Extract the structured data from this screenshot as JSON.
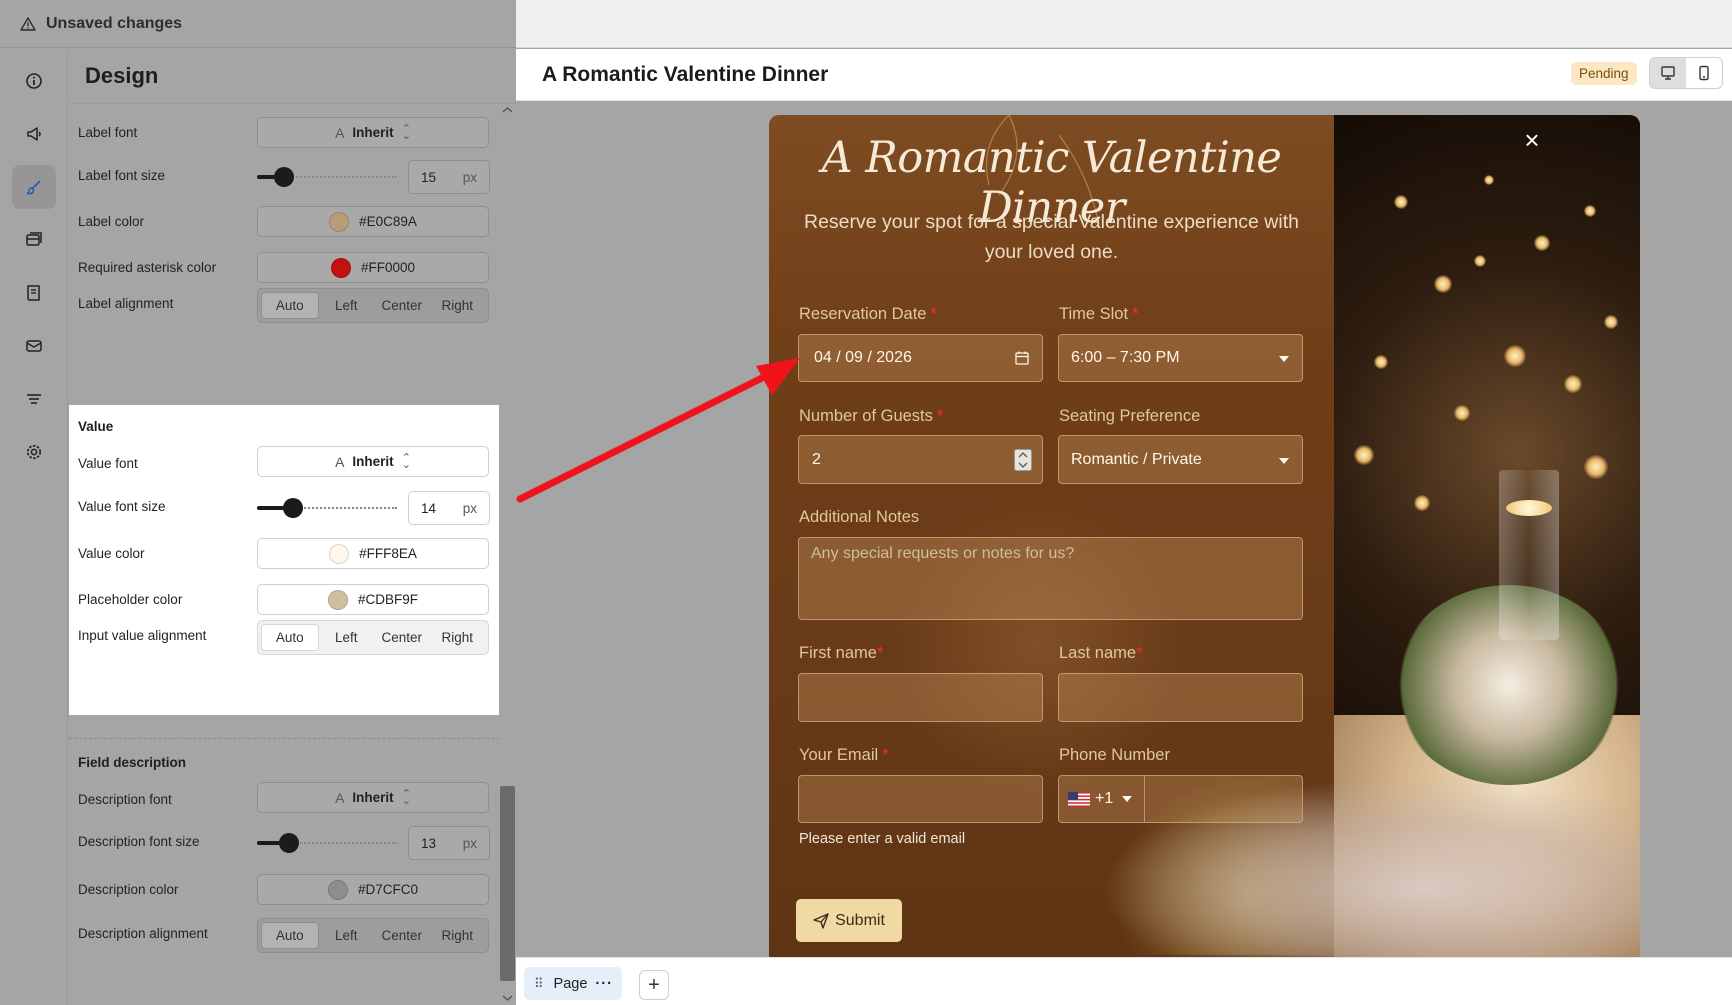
{
  "topbar": {
    "label": "Unsaved changes"
  },
  "rail": {
    "icons": [
      "info-icon",
      "megaphone-icon",
      "brush-icon",
      "layers-icon",
      "book-icon",
      "mail-icon",
      "filter-lines-icon",
      "settings-icon"
    ]
  },
  "panel": {
    "heading": "Design",
    "label_section": {
      "label_font": {
        "label": "Label font",
        "value": "Inherit"
      },
      "label_font_size": {
        "label": "Label font size",
        "value": "15",
        "unit": "px"
      },
      "label_color": {
        "label": "Label color",
        "value": "#E0C89A",
        "swatch": "#B89B78"
      },
      "required_asterisk_color": {
        "label": "Required asterisk color",
        "value": "#FF0000",
        "swatch": "#C41010"
      },
      "label_alignment": {
        "label": "Label alignment",
        "options": [
          "Auto",
          "Left",
          "Center",
          "Right"
        ],
        "selected": "Auto"
      }
    },
    "value_section": {
      "title": "Value",
      "value_font": {
        "label": "Value font",
        "value": "Inherit"
      },
      "value_font_size": {
        "label": "Value font size",
        "value": "14",
        "unit": "px"
      },
      "value_color": {
        "label": "Value color",
        "value": "#FFF8EA",
        "swatch": "#FFF8EA"
      },
      "placeholder_color": {
        "label": "Placeholder color",
        "value": "#CDBF9F",
        "swatch": "#CDBF9F"
      },
      "input_value_alignment": {
        "label": "Input value alignment",
        "options": [
          "Auto",
          "Left",
          "Center",
          "Right"
        ],
        "selected": "Auto"
      }
    },
    "description_section": {
      "title": "Field description",
      "description_font": {
        "label": "Description font",
        "value": "Inherit"
      },
      "description_font_size": {
        "label": "Description font size",
        "value": "13",
        "unit": "px"
      },
      "description_color": {
        "label": "Description color",
        "value": "#D7CFC0",
        "swatch": "#8E8E8E"
      },
      "description_alignment": {
        "label": "Description alignment",
        "options": [
          "Auto",
          "Left",
          "Center",
          "Right"
        ],
        "selected": "Auto"
      }
    }
  },
  "preview": {
    "title": "A Romantic Valentine Dinner",
    "status": "Pending",
    "page_tab": "Page",
    "add_page": "+",
    "form": {
      "title": "A Romantic Valentine Dinner",
      "subtitle": "Reserve your spot for a special Valentine experience with your loved one.",
      "close": "×",
      "reservation_date": {
        "label": "Reservation Date",
        "value": "04 / 09 / 2026"
      },
      "time_slot": {
        "label": "Time Slot",
        "value": "6:00 – 7:30 PM"
      },
      "guests": {
        "label": "Number of Guests",
        "value": "2"
      },
      "seating": {
        "label": "Seating Preference",
        "value": "Romantic / Private"
      },
      "notes": {
        "label": "Additional Notes",
        "placeholder": "Any special requests or notes for us?"
      },
      "first_name": {
        "label": "First name"
      },
      "last_name": {
        "label": "Last name"
      },
      "email": {
        "label": "Your Email",
        "hint": "Please enter a valid email"
      },
      "phone": {
        "label": "Phone Number",
        "code": "+1"
      },
      "asterisk": "*",
      "submit": "Submit"
    }
  },
  "colors": {
    "annotation_arrow": "#F0141A",
    "pending_bg": "#FBE7C2"
  }
}
